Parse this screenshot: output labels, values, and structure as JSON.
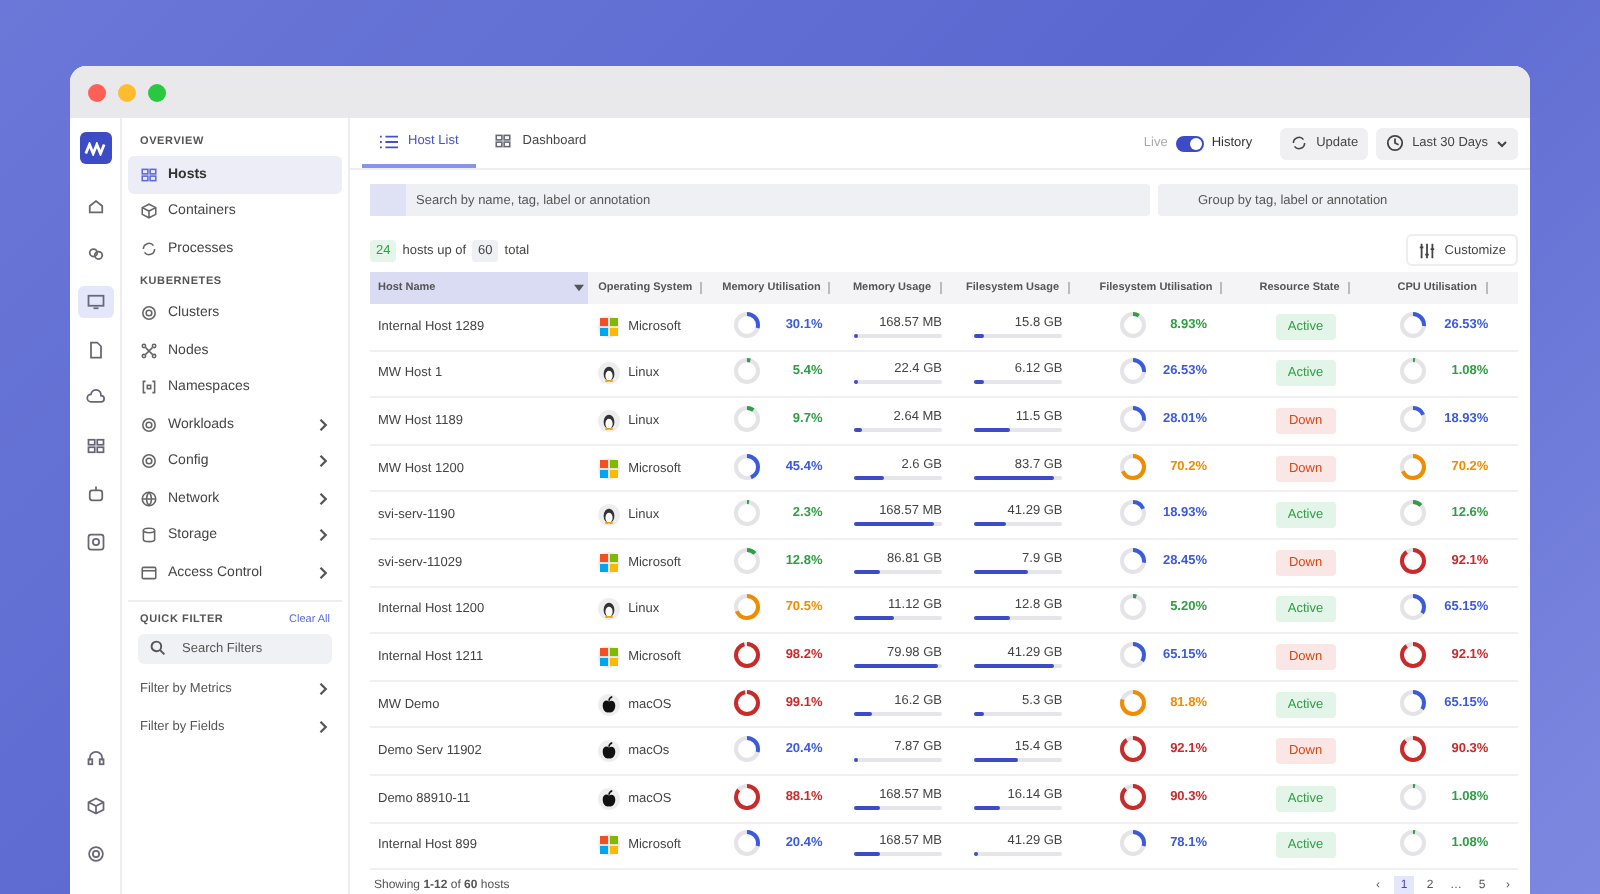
{
  "rail": {
    "top": [
      {
        "selected": false
      },
      {
        "selected": false
      },
      {
        "selected": true
      },
      {
        "selected": false
      },
      {
        "selected": false
      },
      {
        "selected": false
      },
      {
        "selected": false
      },
      {
        "selected": false
      }
    ],
    "bottom": [
      {
        "selected": false
      },
      {
        "selected": false
      },
      {
        "selected": false
      }
    ]
  },
  "sidebar": {
    "sections": [
      {
        "title": "OVERVIEW",
        "items": [
          {
            "label": "Hosts",
            "selected": true,
            "expandable": false
          },
          {
            "label": "Containers",
            "selected": false,
            "expandable": false
          },
          {
            "label": "Processes",
            "selected": false,
            "expandable": false
          }
        ]
      },
      {
        "title": "KUBERNETES",
        "items": [
          {
            "label": "Clusters",
            "selected": false,
            "expandable": false
          },
          {
            "label": "Nodes",
            "selected": false,
            "expandable": false
          },
          {
            "label": "Namespaces",
            "selected": false,
            "expandable": false
          },
          {
            "label": "Workloads",
            "selected": false,
            "expandable": true
          },
          {
            "label": "Config",
            "selected": false,
            "expandable": true
          },
          {
            "label": "Network",
            "selected": false,
            "expandable": true
          },
          {
            "label": "Storage",
            "selected": false,
            "expandable": true
          },
          {
            "label": "Access Control",
            "selected": false,
            "expandable": true
          }
        ]
      }
    ],
    "quick_filter": {
      "title": "QUICK FILTER",
      "clear": "Clear All",
      "search_placeholder": "Search Filters",
      "filters": [
        "Filter by Metrics",
        "Filter by Fields"
      ]
    }
  },
  "tabs": [
    {
      "label": "Host List",
      "selected": true
    },
    {
      "label": "Dashboard",
      "selected": false
    }
  ],
  "toolbar": {
    "live": "Live",
    "history": "History",
    "history_on": true,
    "update": "Update",
    "range": "Last 30 Days"
  },
  "search": {
    "placeholder": "Search by name, tag, label or annotation"
  },
  "group": {
    "placeholder": "Group by tag, label or annotation"
  },
  "summary": {
    "up": "24",
    "up_text": "hosts up of",
    "total": "60",
    "total_text": "total",
    "customize": "Customize"
  },
  "table": {
    "columns": [
      "Host Name",
      "Operating System",
      "Memory Utilisation",
      "Memory Usage",
      "Filesystem Usage",
      "Filesystem Utilisation",
      "Resource State",
      "CPU Utilisation"
    ],
    "rows": [
      {
        "name": "Internal Host 1289",
        "os": {
          "label": "Microsoft",
          "kind": "windows"
        },
        "mem_util": {
          "value": "30.1%",
          "level": 0.3,
          "color": "#3b5bdb"
        },
        "mem_usage": {
          "value": "168.57 MB",
          "level": 0.05
        },
        "fs_usage": {
          "value": "15.8 GB",
          "level": 0.1
        },
        "fs_util": {
          "value": "8.93%",
          "level": 0.09,
          "color": "#2f9e44"
        },
        "state": {
          "label": "Active",
          "kind": "active"
        },
        "cpu": {
          "value": "26.53%",
          "level": 0.27,
          "color": "#3b5bdb"
        }
      },
      {
        "name": "MW Host 1",
        "os": {
          "label": "Linux",
          "kind": "linux"
        },
        "mem_util": {
          "value": "5.4%",
          "level": 0.05,
          "color": "#2f9e44"
        },
        "mem_usage": {
          "value": "22.4 GB",
          "level": 0.05
        },
        "fs_usage": {
          "value": "6.12 GB",
          "level": 0.1
        },
        "fs_util": {
          "value": "26.53%",
          "level": 0.27,
          "color": "#3b5bdb"
        },
        "state": {
          "label": "Active",
          "kind": "active"
        },
        "cpu": {
          "value": "1.08%",
          "level": 0.03,
          "color": "#2f9e44"
        }
      },
      {
        "name": "MW Host 1189",
        "os": {
          "label": "Linux",
          "kind": "linux"
        },
        "mem_util": {
          "value": "9.7%",
          "level": 0.1,
          "color": "#2f9e44"
        },
        "mem_usage": {
          "value": "2.64 MB",
          "level": 0.08
        },
        "fs_usage": {
          "value": "11.5 GB",
          "level": 0.4
        },
        "fs_util": {
          "value": "28.01%",
          "level": 0.28,
          "color": "#3b5bdb"
        },
        "state": {
          "label": "Down",
          "kind": "down"
        },
        "cpu": {
          "value": "18.93%",
          "level": 0.19,
          "color": "#3b5bdb"
        }
      },
      {
        "name": "MW Host 1200",
        "os": {
          "label": "Microsoft",
          "kind": "windows"
        },
        "mem_util": {
          "value": "45.4%",
          "level": 0.45,
          "color": "#3b5bdb"
        },
        "mem_usage": {
          "value": "2.6 GB",
          "level": 0.35
        },
        "fs_usage": {
          "value": "83.7 GB",
          "level": 0.9
        },
        "fs_util": {
          "value": "70.2%",
          "level": 0.7,
          "color": "#f08c00"
        },
        "state": {
          "label": "Down",
          "kind": "down"
        },
        "cpu": {
          "value": "70.2%",
          "level": 0.7,
          "color": "#f08c00"
        }
      },
      {
        "name": "svi-serv-1190",
        "os": {
          "label": "Linux",
          "kind": "linux"
        },
        "mem_util": {
          "value": "2.3%",
          "level": 0.03,
          "color": "#2f9e44"
        },
        "mem_usage": {
          "value": "168.57 MB",
          "level": 0.9
        },
        "fs_usage": {
          "value": "41.29 GB",
          "level": 0.35
        },
        "fs_util": {
          "value": "18.93%",
          "level": 0.19,
          "color": "#3b5bdb"
        },
        "state": {
          "label": "Active",
          "kind": "active"
        },
        "cpu": {
          "value": "12.6%",
          "level": 0.13,
          "color": "#2f9e44"
        }
      },
      {
        "name": "svi-serv-11029",
        "os": {
          "label": "Microsoft",
          "kind": "windows"
        },
        "mem_util": {
          "value": "12.8%",
          "level": 0.13,
          "color": "#2f9e44"
        },
        "mem_usage": {
          "value": "86.81 GB",
          "level": 0.3
        },
        "fs_usage": {
          "value": "7.9 GB",
          "level": 0.6
        },
        "fs_util": {
          "value": "28.45%",
          "level": 0.28,
          "color": "#3b5bdb"
        },
        "state": {
          "label": "Down",
          "kind": "down"
        },
        "cpu": {
          "value": "92.1%",
          "level": 0.92,
          "color": "#c92a2a"
        }
      },
      {
        "name": "Internal Host 1200",
        "os": {
          "label": "Linux",
          "kind": "linux"
        },
        "mem_util": {
          "value": "70.5%",
          "level": 0.7,
          "color": "#f08c00"
        },
        "mem_usage": {
          "value": "11.12 GB",
          "level": 0.45
        },
        "fs_usage": {
          "value": "12.8 GB",
          "level": 0.4
        },
        "fs_util": {
          "value": "5.20%",
          "level": 0.05,
          "color": "#2f9e44"
        },
        "state": {
          "label": "Active",
          "kind": "active"
        },
        "cpu": {
          "value": "65.15%",
          "level": 0.35,
          "color": "#3b5bdb"
        }
      },
      {
        "name": "Internal Host 1211",
        "os": {
          "label": "Microsoft",
          "kind": "windows"
        },
        "mem_util": {
          "value": "98.2%",
          "level": 0.98,
          "color": "#c92a2a"
        },
        "mem_usage": {
          "value": "79.98 GB",
          "level": 0.95
        },
        "fs_usage": {
          "value": "41.29 GB",
          "level": 0.9
        },
        "fs_util": {
          "value": "65.15%",
          "level": 0.35,
          "color": "#3b5bdb"
        },
        "state": {
          "label": "Down",
          "kind": "down"
        },
        "cpu": {
          "value": "92.1%",
          "level": 0.92,
          "color": "#c92a2a"
        }
      },
      {
        "name": "MW Demo",
        "os": {
          "label": "macOS",
          "kind": "apple"
        },
        "mem_util": {
          "value": "99.1%",
          "level": 0.99,
          "color": "#c92a2a"
        },
        "mem_usage": {
          "value": "16.2 GB",
          "level": 0.2
        },
        "fs_usage": {
          "value": "5.3 GB",
          "level": 0.1
        },
        "fs_util": {
          "value": "81.8%",
          "level": 0.82,
          "color": "#f08c00"
        },
        "state": {
          "label": "Active",
          "kind": "active"
        },
        "cpu": {
          "value": "65.15%",
          "level": 0.35,
          "color": "#3b5bdb"
        }
      },
      {
        "name": "Demo Serv 11902",
        "os": {
          "label": "macOs",
          "kind": "apple"
        },
        "mem_util": {
          "value": "20.4%",
          "level": 0.3,
          "color": "#3b5bdb"
        },
        "mem_usage": {
          "value": "7.87 GB",
          "level": 0.05
        },
        "fs_usage": {
          "value": "15.4 GB",
          "level": 0.5
        },
        "fs_util": {
          "value": "92.1%",
          "level": 0.92,
          "color": "#c92a2a"
        },
        "state": {
          "label": "Down",
          "kind": "down"
        },
        "cpu": {
          "value": "90.3%",
          "level": 0.9,
          "color": "#c92a2a"
        }
      },
      {
        "name": "Demo 88910-11",
        "os": {
          "label": "macOS",
          "kind": "apple"
        },
        "mem_util": {
          "value": "88.1%",
          "level": 0.88,
          "color": "#c92a2a"
        },
        "mem_usage": {
          "value": "168.57 MB",
          "level": 0.3
        },
        "fs_usage": {
          "value": "16.14 GB",
          "level": 0.3
        },
        "fs_util": {
          "value": "90.3%",
          "level": 0.9,
          "color": "#c92a2a"
        },
        "state": {
          "label": "Active",
          "kind": "active"
        },
        "cpu": {
          "value": "1.08%",
          "level": 0.03,
          "color": "#2f9e44"
        }
      },
      {
        "name": "Internal Host 899",
        "os": {
          "label": "Microsoft",
          "kind": "windows"
        },
        "mem_util": {
          "value": "20.4%",
          "level": 0.3,
          "color": "#3b5bdb"
        },
        "mem_usage": {
          "value": "168.57 MB",
          "level": 0.3
        },
        "fs_usage": {
          "value": "41.29 GB",
          "level": 0.05
        },
        "fs_util": {
          "value": "78.1%",
          "level": 0.3,
          "color": "#3b5bdb"
        },
        "state": {
          "label": "Active",
          "kind": "active"
        },
        "cpu": {
          "value": "1.08%",
          "level": 0.03,
          "color": "#2f9e44"
        }
      }
    ]
  },
  "footer": {
    "showing": "Showing **1-12** of **60** hosts",
    "pages": [
      {
        "label": "‹",
        "selected": false
      },
      {
        "label": "1",
        "selected": true
      },
      {
        "label": "2",
        "selected": false
      },
      {
        "label": "…",
        "selected": false
      },
      {
        "label": "5",
        "selected": false
      },
      {
        "label": "›",
        "selected": false
      }
    ]
  }
}
